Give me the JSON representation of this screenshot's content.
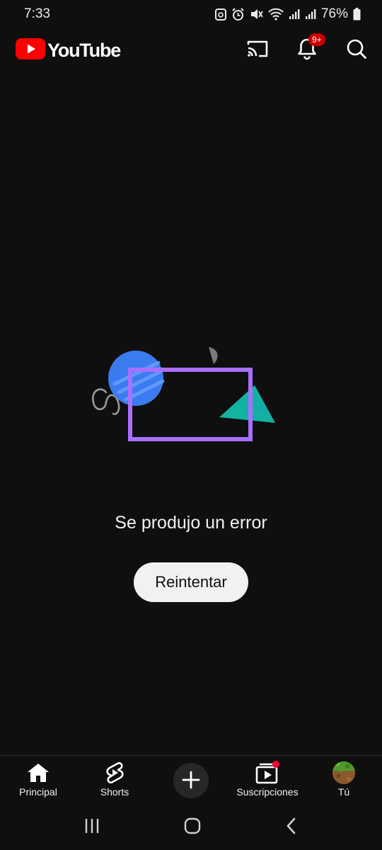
{
  "status": {
    "time": "7:33",
    "battery": "76%"
  },
  "header": {
    "logo_text": "YouTube",
    "notifications_badge": "9+"
  },
  "error": {
    "message": "Se produjo un error",
    "retry_label": "Reintentar"
  },
  "nav": {
    "home": "Principal",
    "shorts": "Shorts",
    "subscriptions": "Suscripciones",
    "you": "Tú"
  },
  "colors": {
    "brand_red": "#ff0000",
    "background": "#0f0f0f",
    "illustration_purple": "#a970ff",
    "illustration_blue": "#3a7cf0",
    "illustration_teal": "#12b3a0"
  }
}
